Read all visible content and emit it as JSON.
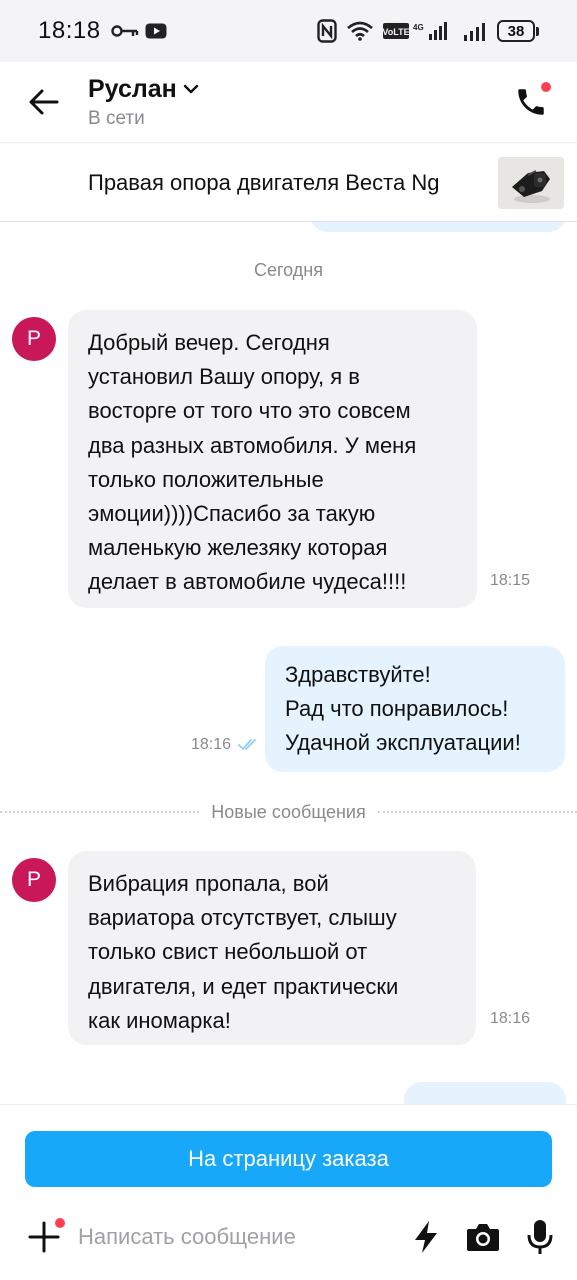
{
  "status_bar": {
    "time": "18:18",
    "battery": "38"
  },
  "header": {
    "contact_name": "Руслан",
    "contact_status": "В сети"
  },
  "product": {
    "title": "Правая опора двигателя Веста Ng"
  },
  "messages": {
    "date_separator": "Сегодня",
    "new_messages_separator": "Новые сообщения",
    "items": [
      {
        "direction": "in",
        "avatar_letter": "Р",
        "lines": [
          "Добрый вечер. Сегодня",
          "установил Вашу опору, я в",
          "восторге от того что это совсем",
          "два разных автомобиля. У меня",
          "только положительные",
          "эмоции))))Спасибо за такую",
          "маленькую железяку которая",
          "делает в автомобиле чудеса!!!!"
        ],
        "time": "18:15"
      },
      {
        "direction": "out",
        "lines": [
          "Здравствуйте!",
          "Рад что понравилось!",
          "Удачной эксплуатации!"
        ],
        "time": "18:16",
        "read": true
      },
      {
        "direction": "in",
        "avatar_letter": "Р",
        "lines": [
          "Вибрация пропала, вой",
          "вариатора отсутствует, слышу",
          "только свист небольшой от",
          "двигателя, и едет практически",
          "как иномарка!"
        ],
        "time": "18:16"
      }
    ]
  },
  "bottom": {
    "order_button_label": "На страницу заказа",
    "composer_placeholder": "Написать сообщение"
  },
  "icons": {
    "back": "arrow-left-icon",
    "dropdown": "chevron-down-icon",
    "call": "phone-icon",
    "attach": "plus-icon",
    "quick_replies": "lightning-icon",
    "camera": "camera-icon",
    "voice": "microphone-icon",
    "read_receipt": "double-check-icon"
  },
  "colors": {
    "accent": "#17a8fa",
    "incoming_bubble": "#f2f2f4",
    "outgoing_bubble": "#e4f3fd",
    "avatar": "#c8185a",
    "notification_dot": "#ff4053",
    "read_checks": "#8fd0f5"
  }
}
